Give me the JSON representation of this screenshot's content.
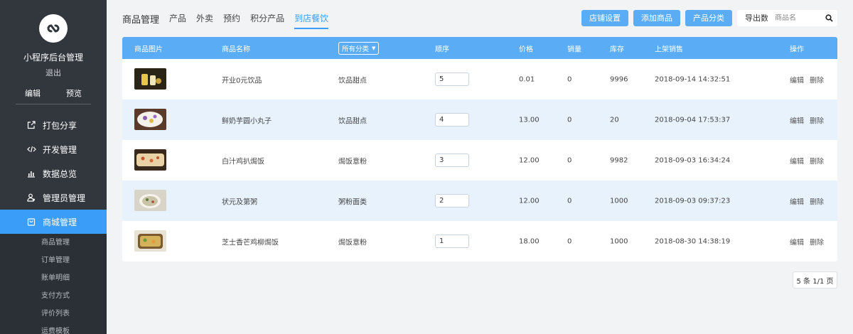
{
  "sidebar": {
    "app_name": "小程序后台管理",
    "logout": "退出",
    "edit": "编辑",
    "preview": "预览",
    "items": [
      {
        "label": "打包分享",
        "icon": "share-icon"
      },
      {
        "label": "开发管理",
        "icon": "code-icon"
      },
      {
        "label": "数据总览",
        "icon": "bar-chart-icon"
      },
      {
        "label": "管理员管理",
        "icon": "admin-user-icon"
      },
      {
        "label": "商城管理",
        "icon": "shop-bag-icon",
        "active": true
      }
    ],
    "subitems": [
      "商品管理",
      "订单管理",
      "账单明细",
      "支付方式",
      "评价列表",
      "运费模板"
    ]
  },
  "tabs": [
    "商品管理",
    "产品",
    "外卖",
    "预约",
    "积分产品",
    "到店餐饮"
  ],
  "active_tab": "到店餐饮",
  "actions": {
    "shop_settings": "店铺设置",
    "add_product": "添加商品",
    "product_category": "产品分类",
    "export_data": "导出数据"
  },
  "search": {
    "placeholder": "商品名",
    "value": ""
  },
  "table": {
    "headers": {
      "image": "商品图片",
      "name": "商品名称",
      "category_filter": "所有分类",
      "order": "顺序",
      "price": "价格",
      "sales": "销量",
      "stock": "库存",
      "listed_time": "上架销售",
      "ops": "操作"
    },
    "rows": [
      {
        "name": "开业0元饮品",
        "category": "饮品甜点",
        "order": "5",
        "price": "0.01",
        "sales": "0",
        "stock": "9996",
        "time": "2018-09-14 14:32:51"
      },
      {
        "name": "鲜奶芋圆小丸子",
        "category": "饮品甜点",
        "order": "4",
        "price": "13.00",
        "sales": "0",
        "stock": "20",
        "time": "2018-09-04 17:53:37"
      },
      {
        "name": "白汁鸡扒焗饭",
        "category": "焗饭意粉",
        "order": "3",
        "price": "12.00",
        "sales": "0",
        "stock": "9982",
        "time": "2018-09-03 16:34:24"
      },
      {
        "name": "状元及第粥",
        "category": "粥粉面类",
        "order": "2",
        "price": "12.00",
        "sales": "0",
        "stock": "1000",
        "time": "2018-09-03 09:37:23"
      },
      {
        "name": "芝士香芒鸡柳焗饭",
        "category": "焗饭意粉",
        "order": "1",
        "price": "18.00",
        "sales": "0",
        "stock": "1000",
        "time": "2018-08-30 14:38:19"
      }
    ],
    "edit_label": "编辑",
    "delete_label": "删除"
  },
  "pagination": "5 条 1/1 页",
  "colors": {
    "accent": "#3a9df8",
    "header": "#5aacf4",
    "sidebar": "#32373d",
    "row_alt": "#e7f2fd"
  }
}
